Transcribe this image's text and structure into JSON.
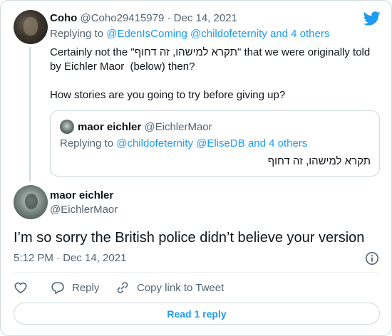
{
  "colors": {
    "accent": "#1d9bf0",
    "muted": "#536471",
    "text": "#0f1419",
    "border": "#cfd9de"
  },
  "parent_tweet": {
    "author_name": "Coho",
    "handle": "@Coho29415979",
    "separator": "·",
    "date": "Dec 14, 2021",
    "replying_prefix": "Replying to",
    "replying_users": "@EdenIsComing @childofeternity",
    "replying_suffix": "and 4 others",
    "text": "Certainly not the \"תקרא למישהו, זה דחוף\" that we were originally told by Eichler Maor  (below) then?\n\nHow stories are you going to try before giving up?"
  },
  "quoted_tweet": {
    "author_name": "maor eichler",
    "handle": "@EichlerMaor",
    "replying_prefix": "Replying to",
    "replying_users": "@childofeternity @EliseDB",
    "replying_suffix": "and 4 others",
    "text": "תקרא למישהו, זה דחוף"
  },
  "main_tweet": {
    "author_name": "maor eichler",
    "handle": "@EichlerMaor",
    "text": "I’m so sorry the British police didn’t believe your version",
    "timestamp": "5:12 PM · Dec 14, 2021"
  },
  "actions": {
    "reply_label": "Reply",
    "copy_label": "Copy link to Tweet",
    "read_replies_label": "Read 1 reply"
  },
  "icons": [
    "twitter-bird-icon",
    "heart-icon",
    "reply-icon",
    "link-icon",
    "info-icon"
  ]
}
